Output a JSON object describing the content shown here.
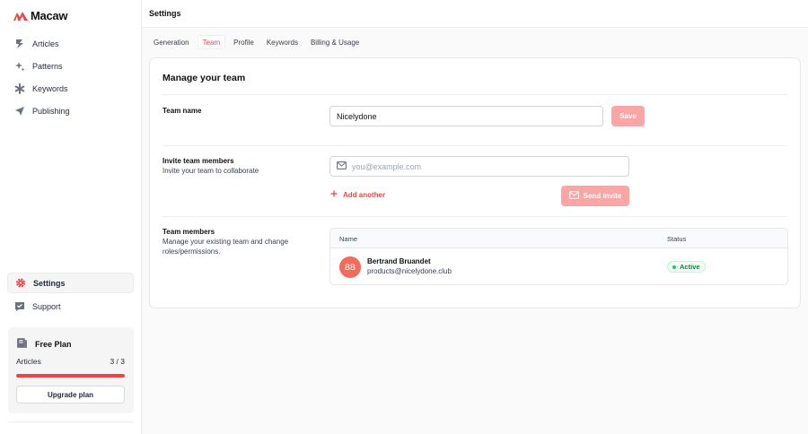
{
  "brand": {
    "name": "Macaw"
  },
  "sidebar": {
    "items": [
      {
        "label": "Articles",
        "icon": "lightning-icon"
      },
      {
        "label": "Patterns",
        "icon": "sparkles-icon"
      },
      {
        "label": "Keywords",
        "icon": "asterisk-icon"
      },
      {
        "label": "Publishing",
        "icon": "paper-plane-icon"
      }
    ],
    "bottom_items": [
      {
        "label": "Settings",
        "icon": "gear-icon",
        "active": true
      },
      {
        "label": "Support",
        "icon": "chat-icon"
      }
    ],
    "plan": {
      "title": "Free Plan",
      "usage_label": "Articles",
      "usage_value": "3 / 3",
      "progress": 1.0,
      "upgrade_label": "Upgrade plan"
    }
  },
  "header": {
    "title": "Settings"
  },
  "tabs": [
    {
      "label": "Generation"
    },
    {
      "label": "Team",
      "active": true
    },
    {
      "label": "Profile"
    },
    {
      "label": "Keywords"
    },
    {
      "label": "Billing & Usage"
    }
  ],
  "team": {
    "card_title": "Manage your team",
    "name_section": {
      "label": "Team name",
      "value": "Nicelydone",
      "save_label": "Save"
    },
    "invite_section": {
      "label": "Invite team members",
      "sub": "Invite your team to collaborate",
      "placeholder": "you@example.com",
      "add_another": "Add another",
      "send_invite": "Send invite"
    },
    "members_section": {
      "label": "Team members",
      "sub": "Manage your existing team and change roles/permissions.",
      "columns": [
        "Name",
        "Status"
      ],
      "rows": [
        {
          "initials": "BB",
          "name": "Bertrand Bruandet",
          "email": "products@nicelydone.club",
          "status": "Active"
        }
      ]
    }
  },
  "colors": {
    "accent": "#ef4444",
    "accent_light": "#fca5a5",
    "avatar": "#f26b5b",
    "success": "#22c55e"
  }
}
